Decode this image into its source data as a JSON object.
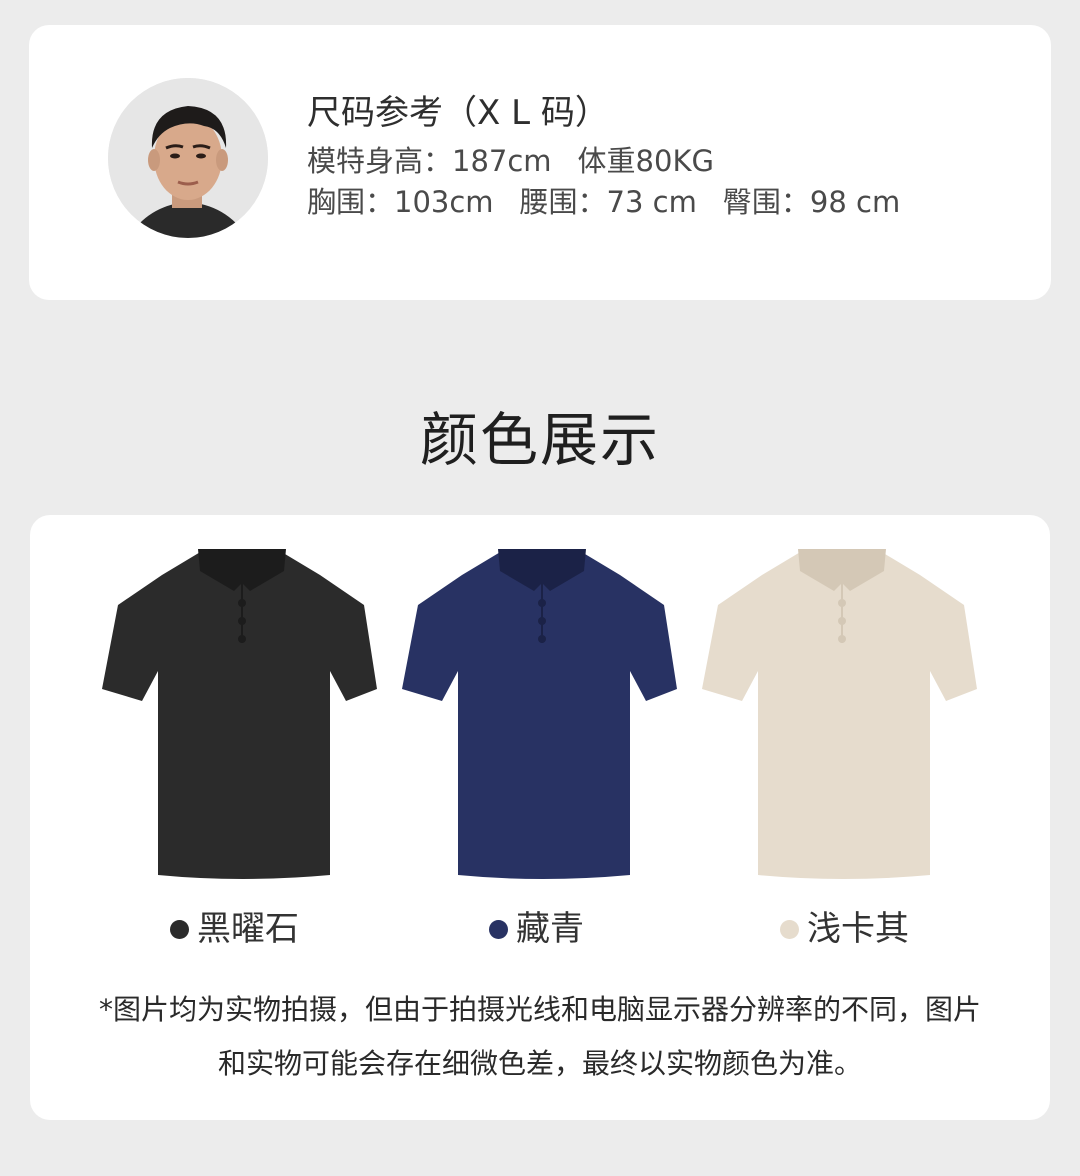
{
  "model": {
    "size_title": "尺码参考（X L 码）",
    "height": "模特身高：187cm",
    "weight": "体重80KG",
    "chest": "胸围：103cm",
    "waist": "腰围：73 cm",
    "hip": "臀围：98 cm"
  },
  "section_title": "颜色展示",
  "colors": [
    {
      "name": "黑曜石",
      "hex": "#2b2b2b",
      "shade": "#1c1c1c"
    },
    {
      "name": "藏青",
      "hex": "#283263",
      "shade": "#1b2247"
    },
    {
      "name": "浅卡其",
      "hex": "#e6dccd",
      "shade": "#d4c8b6"
    }
  ],
  "disclaimer": "*图片均为实物拍摄，但由于拍摄光线和电脑显示器分辨率的不同，图片和实物可能会存在细微色差，最终以实物颜色为准。"
}
